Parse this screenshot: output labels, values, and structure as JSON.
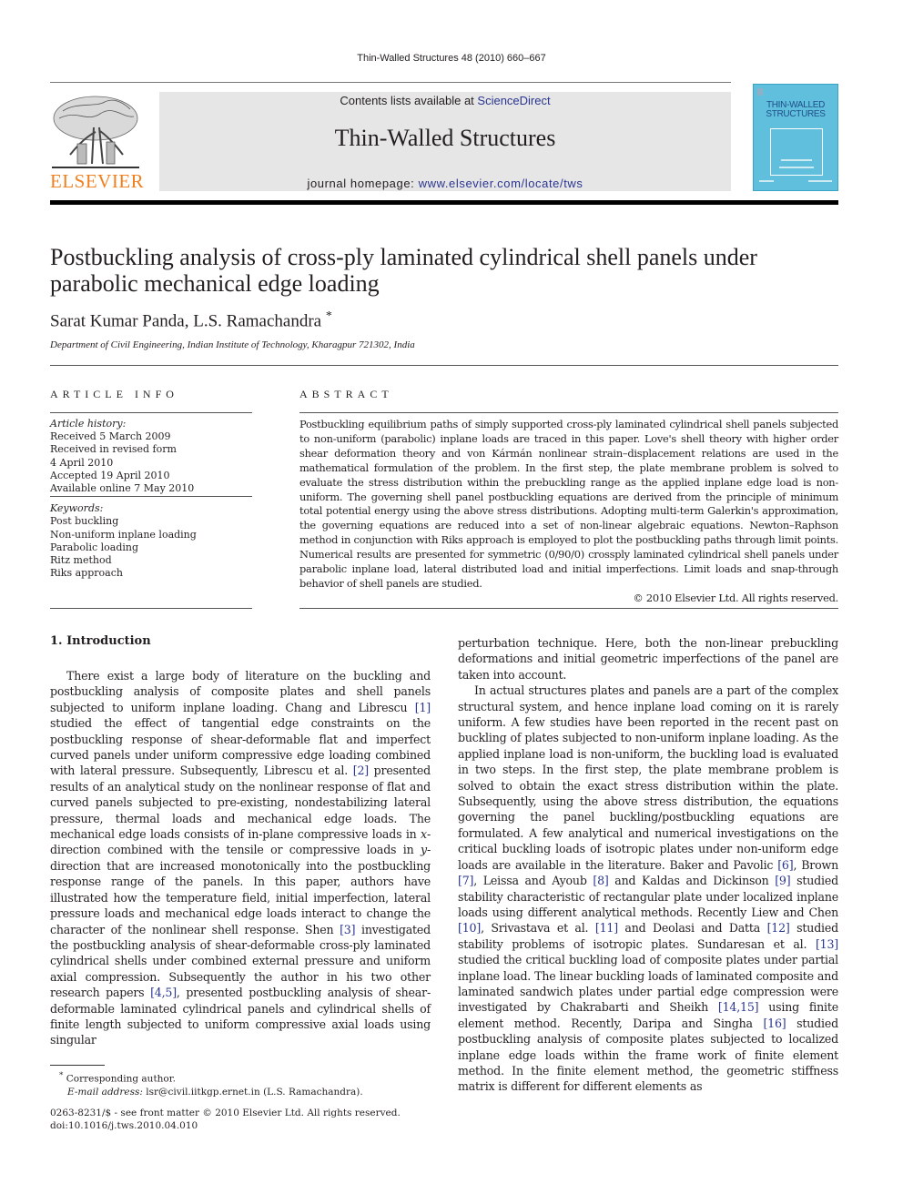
{
  "running_head": "Thin-Walled Structures 48 (2010) 660–667",
  "header": {
    "publisher_wordmark": "ELSEVIER",
    "contents_prefix": "Contents lists available at ",
    "contents_link": "ScienceDirect",
    "journal_title": "Thin-Walled Structures",
    "homepage_prefix": "journal homepage: ",
    "homepage_link": "www.elsevier.com/locate/tws",
    "cover_title_line1": "THIN-WALLED",
    "cover_title_line2": "STRUCTURES",
    "colors": {
      "banner_bg": "#e6e6e7",
      "link": "#2a3590",
      "elsevier_orange": "#f0801f",
      "cover_blue": "#5fbfdc"
    }
  },
  "article": {
    "title": "Postbuckling analysis of cross-ply laminated cylindrical shell panels under parabolic mechanical edge loading",
    "authors": "Sarat Kumar Panda, L.S. Ramachandra",
    "author_mark": "*",
    "affiliation": "Department of Civil Engineering, Indian Institute of Technology, Kharagpur 721302, India"
  },
  "article_info": {
    "heading": "ARTICLE INFO",
    "history_label": "Article history:",
    "history": [
      "Received 5 March 2009",
      "Received in revised form",
      "4 April 2010",
      "Accepted 19 April 2010",
      "Available online 7 May 2010"
    ],
    "keywords_label": "Keywords:",
    "keywords": [
      "Post buckling",
      "Non-uniform inplane loading",
      "Parabolic loading",
      "Ritz method",
      "Riks approach"
    ]
  },
  "abstract": {
    "heading": "ABSTRACT",
    "text": "Postbuckling equilibrium paths of simply supported cross-ply laminated cylindrical shell panels subjected to non-uniform (parabolic) inplane loads are traced in this paper. Love's shell theory with higher order shear deformation theory and von Kármán nonlinear strain–displacement relations are used in the mathematical formulation of the problem. In the first step, the plate membrane problem is solved to evaluate the stress distribution within the prebuckling range as the applied inplane edge load is non-uniform. The governing shell panel postbuckling equations are derived from the principle of minimum total potential energy using the above stress distributions. Adopting multi-term Galerkin's approximation, the governing equations are reduced into a set of non-linear algebraic equations. Newton–Raphson method in conjunction with Riks approach is employed to plot the postbuckling paths through limit points. Numerical results are presented for symmetric (0/90/0) crossply laminated cylindrical shell panels under parabolic inplane load, lateral distributed load and initial imperfections. Limit loads and snap-through behavior of shell panels are studied.",
    "copyright": "© 2010 Elsevier Ltd. All rights reserved."
  },
  "body": {
    "section_heading": "1.  Introduction",
    "left": {
      "p1_a": "There exist a large body of literature on the buckling and postbuckling analysis of composite plates and shell panels subjected to uniform inplane loading. Chang and Librescu ",
      "ref1": "[1]",
      "p1_b": " studied the effect of tangential edge constraints on the postbuckling response of shear-deformable flat and imperfect curved panels under uniform compressive edge loading combined with lateral pressure. Subsequently, Librescu et al. ",
      "ref2": "[2]",
      "p1_c": " presented results of an analytical study on the nonlinear response of flat and curved panels subjected to pre-existing, nondestabilizing lateral pressure, thermal loads and mechanical edge loads. The mechanical edge loads consists of in-plane compressive loads in ",
      "x": "x",
      "p1_d": "-direction combined with the tensile or compressive loads in ",
      "y": "y",
      "p1_e": "-direction that are increased monotonically into the postbuckling response range of the panels. In this paper, authors have illustrated how the temperature field, initial imperfection, lateral pressure loads and mechanical edge loads interact to change the character of the nonlinear shell response. Shen ",
      "ref3": "[3]",
      "p1_f": " investigated the postbuckling analysis of shear-deformable cross-ply laminated cylindrical shells under combined external pressure and uniform axial compression. Subsequently the author in his two other research papers ",
      "ref45": "[4,5]",
      "p1_g": ", presented postbuckling analysis of shear-deformable laminated cylindrical panels and cylindrical shells of finite length subjected to uniform compressive axial loads using singular"
    },
    "right": {
      "p1": "perturbation technique. Here, both the non-linear prebuckling deformations and initial geometric imperfections of the panel are taken into account.",
      "p2_a": "In actual structures plates and panels are a part of the complex structural system, and hence inplane load coming on it is rarely uniform. A few studies have been reported in the recent past on buckling of plates subjected to non-uniform inplane loading. As the applied inplane load is non-uniform, the buckling load is evaluated in two steps. In the first step, the plate membrane problem is solved to obtain the exact stress distribution within the plate. Subsequently, using the above stress distribution, the equations governing the panel buckling/postbuckling equations are formulated. A few analytical and numerical investigations on the critical buckling loads of isotropic plates under non-uniform edge loads are available in the literature. Baker and Pavolic ",
      "ref6": "[6]",
      "p2_b": ", Brown ",
      "ref7": "[7]",
      "p2_c": ", Leissa and Ayoub ",
      "ref8": "[8]",
      "p2_d": " and Kaldas and Dickinson ",
      "ref9": "[9]",
      "p2_e": " studied stability characteristic of rectangular plate under localized inplane loads using different analytical methods. Recently Liew and Chen ",
      "ref10": "[10]",
      "p2_f": ", Srivastava et al. ",
      "ref11": "[11]",
      "p2_g": " and Deolasi and Datta ",
      "ref12": "[12]",
      "p2_h": " studied stability problems of isotropic plates. Sundaresan et al. ",
      "ref13": "[13]",
      "p2_i": " studied the critical buckling load of composite plates under partial inplane load. The linear buckling loads of laminated composite and laminated sandwich plates under partial edge compression were investigated by Chakrabarti and Sheikh ",
      "ref1415": "[14,15]",
      "p2_j": " using finite element method. Recently, Daripa and Singha ",
      "ref16": "[16]",
      "p2_k": " studied postbuckling analysis of composite plates subjected to localized inplane edge loads within the frame work of finite element method. In the finite element method, the geometric stiffness matrix is different for different elements as"
    }
  },
  "footnotes": {
    "corresponding_mark": "*",
    "corresponding": "Corresponding author.",
    "email_label": "E-mail address:",
    "email": " lsr@civil.iitkgp.ernet.in (L.S. Ramachandra).",
    "front_matter": "0263-8231/$ - see front matter © 2010 Elsevier Ltd. All rights reserved.",
    "doi": "doi:10.1016/j.tws.2010.04.010"
  }
}
